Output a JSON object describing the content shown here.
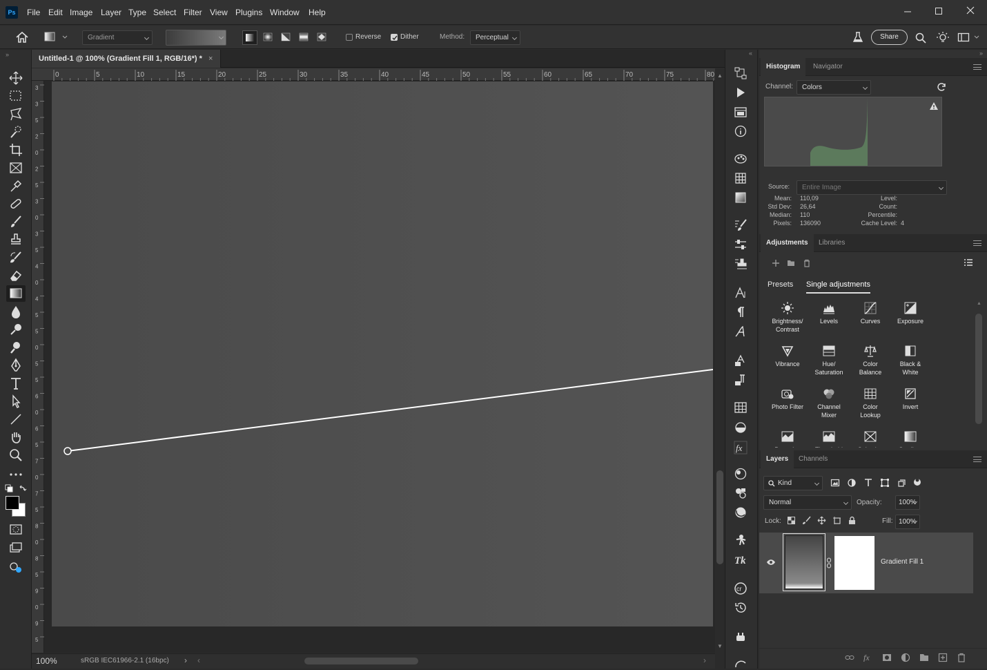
{
  "app": {
    "logo": "Ps"
  },
  "menu": [
    "File",
    "Edit",
    "Image",
    "Layer",
    "Type",
    "Select",
    "Filter",
    "View",
    "Plugins",
    "Window",
    "Help"
  ],
  "options": {
    "preset_placeholder": "Gradient",
    "reverse_label": "Reverse",
    "reverse_checked": false,
    "dither_label": "Dither",
    "dither_checked": true,
    "method_label": "Method:",
    "method_value": "Perceptual",
    "share_label": "Share"
  },
  "document": {
    "tab_title": "Untitled-1 @ 100% (Gradient Fill 1, RGB/16*) *",
    "ruler_labels": [
      "0",
      "5",
      "10",
      "15",
      "20",
      "25",
      "30",
      "35",
      "40",
      "45",
      "50",
      "55",
      "60",
      "65",
      "70",
      "75",
      "80"
    ],
    "vruler_labels": [
      "3",
      "3",
      "5",
      "2",
      "0",
      "2",
      "5",
      "3",
      "0",
      "3",
      "5",
      "4",
      "0",
      "4",
      "5",
      "5",
      "0",
      "5",
      "5",
      "6",
      "0",
      "6",
      "5",
      "7",
      "0",
      "7",
      "5",
      "8",
      "0",
      "8",
      "5",
      "9",
      "0",
      "9",
      "5"
    ],
    "zoom": "100%",
    "color_profile": "sRGB IEC61966-2.1 (16bpc)"
  },
  "histogram": {
    "tabs": [
      "Histogram",
      "Navigator"
    ],
    "channel_label": "Channel:",
    "channel_value": "Colors",
    "source_label": "Source:",
    "source_value": "Entire Image",
    "stats_left": [
      {
        "label": "Mean:",
        "value": "110,09"
      },
      {
        "label": "Std Dev:",
        "value": "26,64"
      },
      {
        "label": "Median:",
        "value": "110"
      },
      {
        "label": "Pixels:",
        "value": "136090"
      }
    ],
    "stats_right": [
      {
        "label": "Level:",
        "value": ""
      },
      {
        "label": "Count:",
        "value": ""
      },
      {
        "label": "Percentile:",
        "value": ""
      },
      {
        "label": "Cache Level:",
        "value": "4"
      }
    ],
    "histo_color": "#5c7a5c"
  },
  "adjustments": {
    "tabs": [
      "Adjustments",
      "Libraries"
    ],
    "subtabs": [
      "Presets",
      "Single adjustments"
    ],
    "items": [
      {
        "label": "Brightness/\nContrast",
        "icon": "sun-icon"
      },
      {
        "label": "Levels",
        "icon": "levels-icon"
      },
      {
        "label": "Curves",
        "icon": "curves-icon"
      },
      {
        "label": "Exposure",
        "icon": "exposure-icon"
      },
      {
        "label": "Vibrance",
        "icon": "vibrance-icon"
      },
      {
        "label": "Hue/\nSaturation",
        "icon": "hue-saturation-icon"
      },
      {
        "label": "Color\nBalance",
        "icon": "color-balance-icon"
      },
      {
        "label": "Black &\nWhite",
        "icon": "black-white-icon"
      },
      {
        "label": "Photo Filter",
        "icon": "photo-filter-icon"
      },
      {
        "label": "Channel\nMixer",
        "icon": "channel-mixer-icon"
      },
      {
        "label": "Color\nLookup",
        "icon": "color-lookup-icon"
      },
      {
        "label": "Invert",
        "icon": "invert-icon"
      },
      {
        "label": "Posterize",
        "icon": "posterize-icon"
      },
      {
        "label": "Threshold",
        "icon": "threshold-icon"
      },
      {
        "label": "Selective",
        "icon": "selective-color-icon"
      },
      {
        "label": "Gradient",
        "icon": "gradient-map-icon"
      }
    ]
  },
  "layers": {
    "tabs": [
      "Layers",
      "Channels"
    ],
    "kind_value": "Kind",
    "blend_mode": "Normal",
    "opacity_label": "Opacity:",
    "opacity_value": "100%",
    "lock_label": "Lock:",
    "fill_label": "Fill:",
    "fill_value": "100%",
    "layer_name": "Gradient Fill 1"
  },
  "colors": {
    "bg": "#2b2b2b",
    "panel": "#323232",
    "accent": "#31a8ff"
  }
}
